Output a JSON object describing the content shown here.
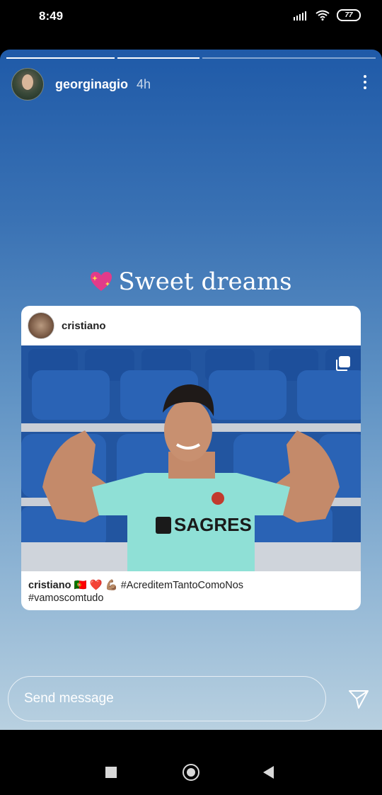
{
  "status_bar": {
    "time": "8:49",
    "battery": "77"
  },
  "story": {
    "username": "georginagio",
    "time_ago": "4h",
    "progress_segments": 3,
    "progress_done": 2,
    "caption_text": "Sweet dreams",
    "caption_icon": "sparkling-heart-icon"
  },
  "shared_post": {
    "username": "cristiano",
    "jersey_text": "SAGRES",
    "caption_user": "cristiano",
    "caption_emojis": "🇵🇹 ❤️ 💪🏽",
    "caption_hashtag_1": "#AcreditemTantoComoNos",
    "caption_hashtag_2": "#vamoscomtudo"
  },
  "reply": {
    "placeholder": "Send message"
  },
  "colors": {
    "story_top": "#1f5aa8",
    "story_bottom": "#b8d0e0",
    "jersey": "#8fe0d6"
  }
}
